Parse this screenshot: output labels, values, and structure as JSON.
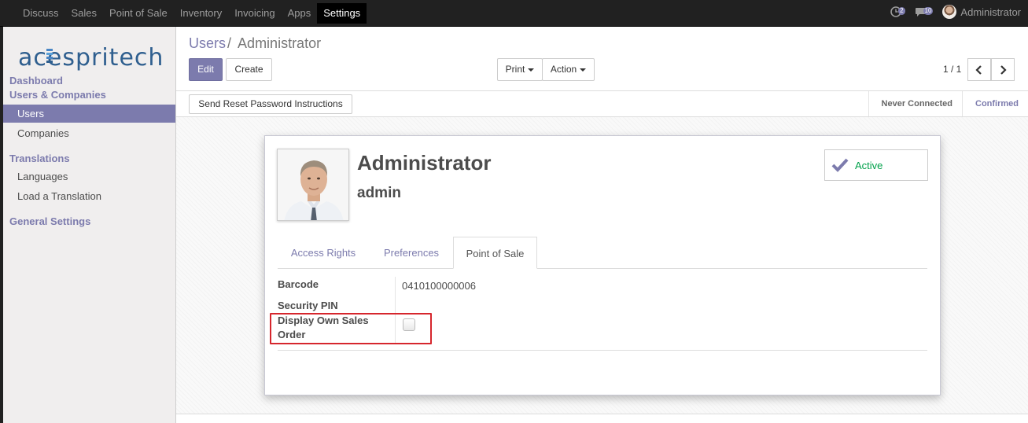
{
  "topbar": {
    "menu": [
      "Discuss",
      "Sales",
      "Point of Sale",
      "Inventory",
      "Invoicing",
      "Apps",
      "Settings"
    ],
    "active_menu": "Settings",
    "activity_count": "2",
    "message_count": "10",
    "user_name": "Administrator"
  },
  "sidebar": {
    "logo_text": "acespritech",
    "dashboard": "Dashboard",
    "users_companies": "Users & Companies",
    "users": "Users",
    "companies": "Companies",
    "translations": "Translations",
    "languages": "Languages",
    "load_translation": "Load a Translation",
    "general_settings": "General Settings"
  },
  "breadcrumb": {
    "parent": "Users",
    "separator": "/",
    "current": "Administrator"
  },
  "toolbar": {
    "edit": "Edit",
    "create": "Create",
    "print": "Print",
    "action": "Action",
    "pager": "1 / 1"
  },
  "header": {
    "reset_password": "Send Reset Password Instructions",
    "stages": [
      "Never Connected",
      "Confirmed"
    ],
    "current_stage": "Confirmed"
  },
  "form": {
    "name": "Administrator",
    "login": "admin",
    "active_label": "Active",
    "tabs": [
      "Access Rights",
      "Preferences",
      "Point of Sale"
    ],
    "active_tab": "Point of Sale",
    "barcode_label": "Barcode",
    "barcode_value": "0410100000006",
    "security_pin_label": "Security PIN",
    "display_own_sales_label_1": "Display Own Sales",
    "display_own_sales_label_2": "Order",
    "display_own_sales_checked": false
  },
  "colors": {
    "brand": "#7c7bad",
    "navbar": "#212121",
    "highlight": "#d6262d"
  }
}
